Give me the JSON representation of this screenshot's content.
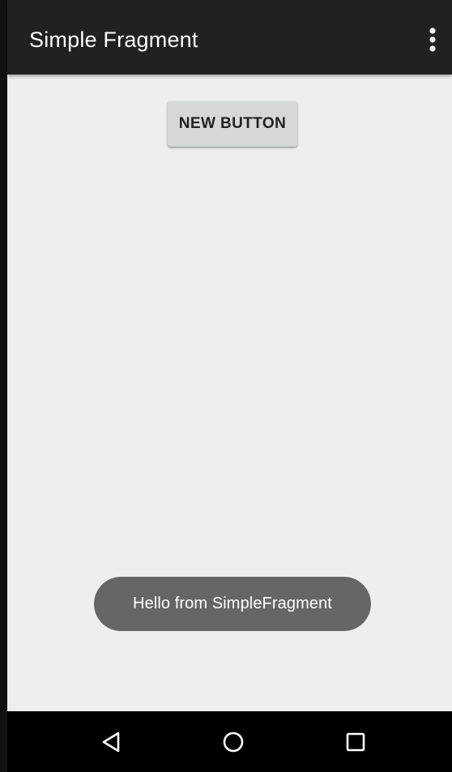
{
  "app_bar": {
    "title": "Simple Fragment",
    "background_color": "#212121",
    "overflow_icon": "more-vert-icon"
  },
  "content": {
    "background_color": "#eeeeee",
    "new_button_label": "NEW BUTTON"
  },
  "toast": {
    "message": "Hello from SimpleFragment",
    "background_color": "#666666"
  },
  "nav_bar": {
    "background_color": "#000000",
    "icons": [
      "back-icon",
      "home-icon",
      "recents-icon"
    ]
  }
}
